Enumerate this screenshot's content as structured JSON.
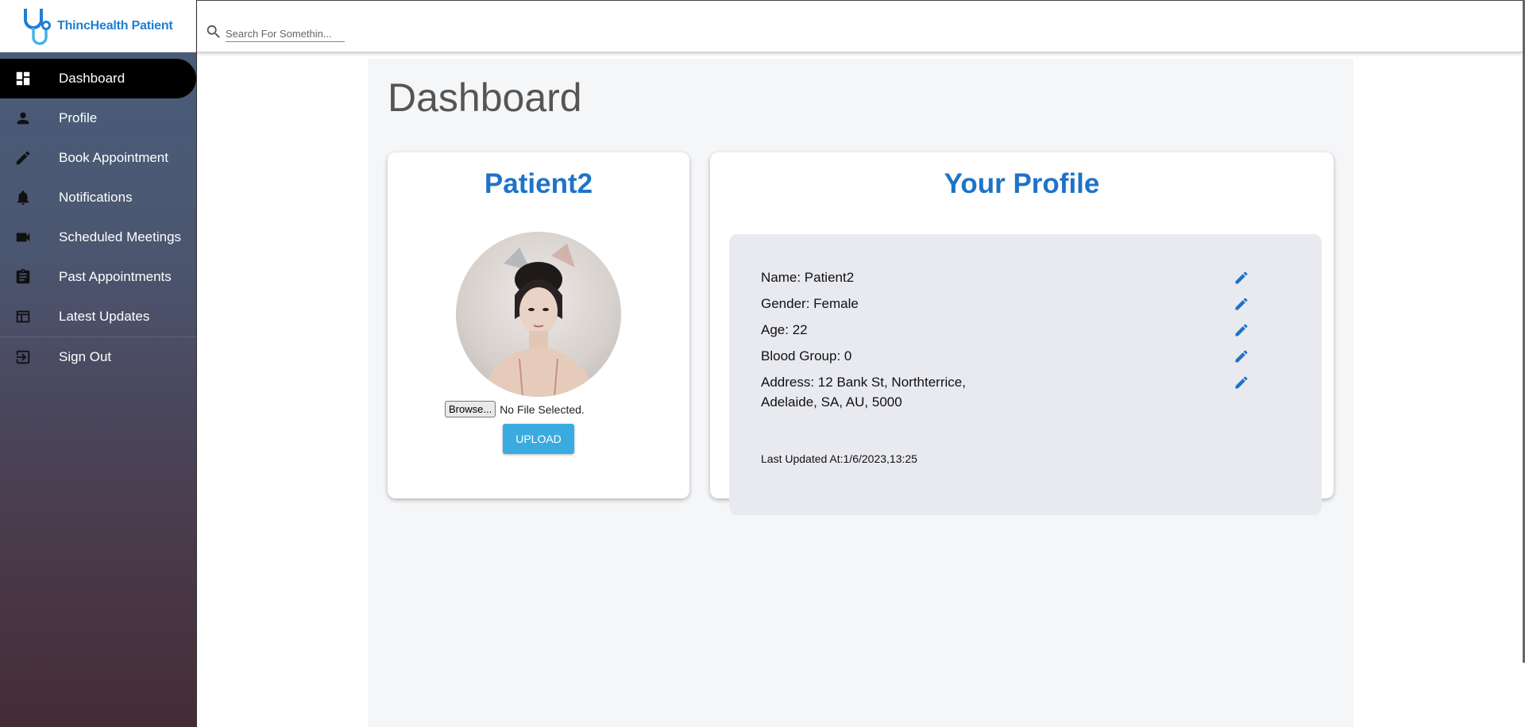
{
  "brand": {
    "name": "ThincHealth Patient"
  },
  "sidebar": {
    "items": [
      {
        "label": "Dashboard"
      },
      {
        "label": "Profile"
      },
      {
        "label": "Book Appointment"
      },
      {
        "label": "Notifications"
      },
      {
        "label": "Scheduled Meetings"
      },
      {
        "label": "Past Appointments"
      },
      {
        "label": "Latest Updates"
      },
      {
        "label": "Sign Out"
      }
    ]
  },
  "search": {
    "placeholder": "Search For Somethin..."
  },
  "main": {
    "title": "Dashboard",
    "patient_card": {
      "name": "Patient2",
      "browse_label": "Browse...",
      "file_status": "No File Selected.",
      "upload_label": "UPLOAD"
    },
    "profile_card": {
      "title": "Your Profile",
      "fields": [
        {
          "label": "Name: Patient2"
        },
        {
          "label": "Gender: Female"
        },
        {
          "label": "Age: 22"
        },
        {
          "label": "Blood Group: 0"
        },
        {
          "label": "Address: 12 Bank St, Northterrice,",
          "label2": "Adelaide, SA, AU, 5000"
        }
      ],
      "last_updated": "Last Updated At:1/6/2023,13:25"
    }
  },
  "colors": {
    "accent": "#1e73c8",
    "upload": "#3aabe0",
    "sidebar_top": "#4a5e7c",
    "sidebar_bottom": "#452c36"
  }
}
